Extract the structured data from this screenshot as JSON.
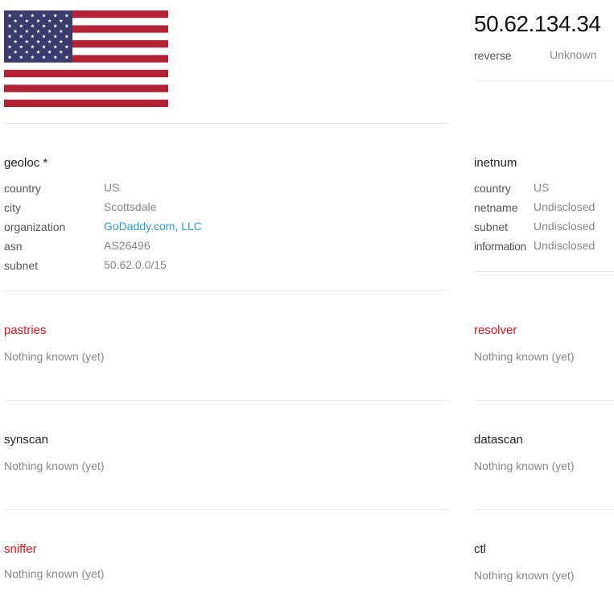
{
  "header": {
    "flag": {
      "country": "US",
      "icon": "us-flag-icon"
    },
    "ip": "50.62.134.34",
    "reverse": {
      "key": "reverse",
      "value": "Unknown"
    }
  },
  "geoloc": {
    "title": "geoloc *",
    "rows": [
      {
        "key": "country",
        "value": "US"
      },
      {
        "key": "city",
        "value": "Scottsdale"
      },
      {
        "key": "organization",
        "value": "GoDaddy.com, LLC"
      },
      {
        "key": "asn",
        "value": "AS26496"
      },
      {
        "key": "subnet",
        "value": "50.62.0.0/15"
      }
    ]
  },
  "inetnum": {
    "title": "inetnum",
    "rows": [
      {
        "key": "country",
        "value": "US"
      },
      {
        "key": "netname",
        "value": "Undisclosed"
      },
      {
        "key": "subnet",
        "value": "Undisclosed"
      },
      {
        "key": "information",
        "value": "Undisclosed"
      }
    ]
  },
  "sections": {
    "pastries": {
      "title": "pastries",
      "text": "Nothing known (yet)"
    },
    "resolver": {
      "title": "resolver",
      "text": "Nothing known (yet)"
    },
    "synscan": {
      "title": "synscan",
      "text": "Nothing known (yet)"
    },
    "datascan": {
      "title": "datascan",
      "text": "Nothing known (yet)"
    },
    "sniffer": {
      "title": "sniffer",
      "text": "Nothing known (yet)"
    },
    "ctl": {
      "title": "ctl",
      "text": "Nothing known (yet)"
    }
  },
  "colors": {
    "alert": "#e8101c",
    "link": "#2a9ed6",
    "flag_red": "#b22234",
    "flag_blue": "#3c3b6e"
  }
}
